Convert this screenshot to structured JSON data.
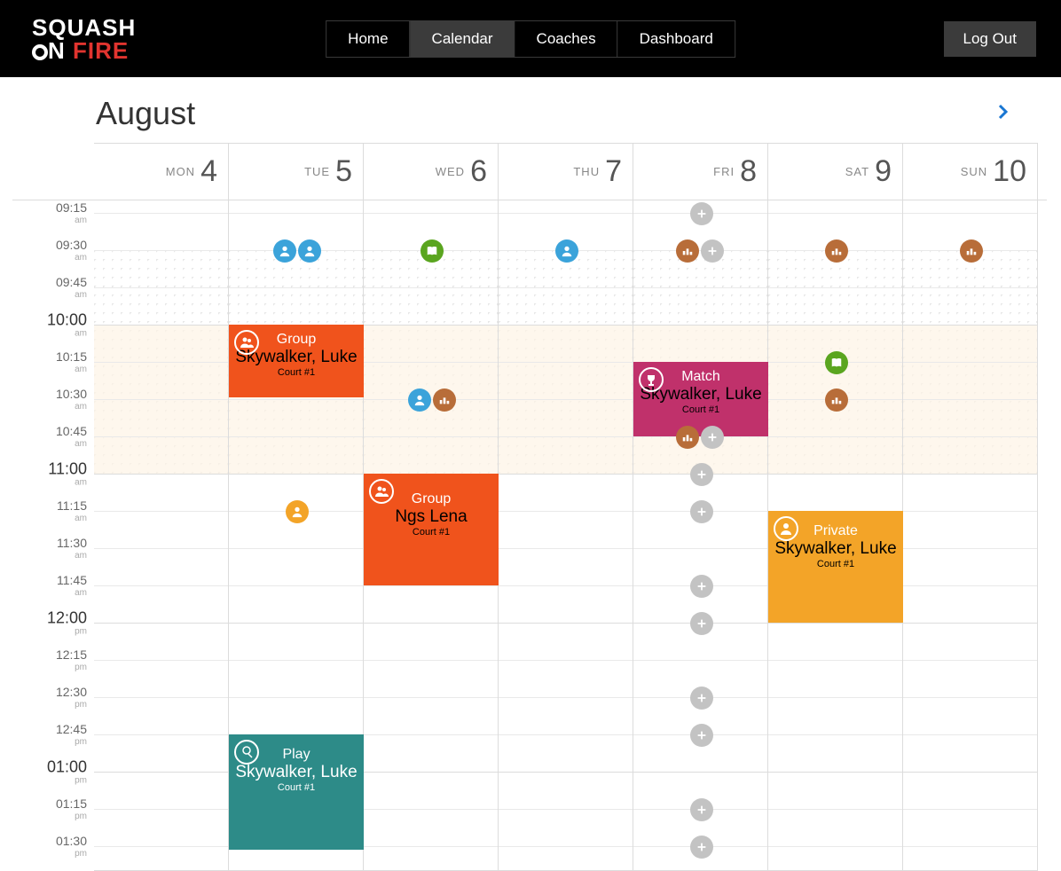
{
  "brand": {
    "line1": "SQUASH",
    "line2_a": "N",
    "line2_b": " FIRE"
  },
  "nav": {
    "home": "Home",
    "calendar": "Calendar",
    "coaches": "Coaches",
    "dashboard": "Dashboard"
  },
  "logout": "Log Out",
  "title": "August",
  "days": [
    {
      "dow": "MON",
      "num": "4"
    },
    {
      "dow": "TUE",
      "num": "5"
    },
    {
      "dow": "WED",
      "num": "6"
    },
    {
      "dow": "THU",
      "num": "7"
    },
    {
      "dow": "FRI",
      "num": "8"
    },
    {
      "dow": "SAT",
      "num": "9"
    },
    {
      "dow": "SUN",
      "num": "10"
    }
  ],
  "timeslots": [
    {
      "t": "09:15",
      "ap": "am",
      "major": false
    },
    {
      "t": "09:30",
      "ap": "am",
      "major": false
    },
    {
      "t": "09:45",
      "ap": "am",
      "major": false
    },
    {
      "t": "10:00",
      "ap": "am",
      "major": true
    },
    {
      "t": "10:15",
      "ap": "am",
      "major": false
    },
    {
      "t": "10:30",
      "ap": "am",
      "major": false
    },
    {
      "t": "10:45",
      "ap": "am",
      "major": false
    },
    {
      "t": "11:00",
      "ap": "am",
      "major": true
    },
    {
      "t": "11:15",
      "ap": "am",
      "major": false
    },
    {
      "t": "11:30",
      "ap": "am",
      "major": false
    },
    {
      "t": "11:45",
      "ap": "am",
      "major": false
    },
    {
      "t": "12:00",
      "ap": "pm",
      "major": true
    },
    {
      "t": "12:15",
      "ap": "pm",
      "major": false
    },
    {
      "t": "12:30",
      "ap": "pm",
      "major": false
    },
    {
      "t": "12:45",
      "ap": "pm",
      "major": false
    },
    {
      "t": "01:00",
      "ap": "pm",
      "major": true
    },
    {
      "t": "01:15",
      "ap": "pm",
      "major": false
    },
    {
      "t": "01:30",
      "ap": "pm",
      "major": false
    }
  ],
  "events": {
    "e1": {
      "type": "Group",
      "name": "Skywalker, Luke",
      "court": "Court #1"
    },
    "e2": {
      "type": "Group",
      "name": "Ngs Lena",
      "court": "Court #1"
    },
    "e3": {
      "type": "Play",
      "name": "Skywalker, Luke",
      "court": "Court #1"
    },
    "e4": {
      "type": "Match",
      "name": "Skywalker, Luke",
      "court": "Court #1"
    },
    "e5": {
      "type": "Private",
      "name": "Skywalker, Luke",
      "court": "Court #1"
    }
  },
  "colors": {
    "orange": "#f0531c",
    "teal": "#2d8b88",
    "pink": "#c0316b",
    "amber": "#f3a428",
    "blue": "#3ba3da",
    "green": "#5aa51f",
    "brown": "#b86d39",
    "grey": "#c3c3c3"
  }
}
